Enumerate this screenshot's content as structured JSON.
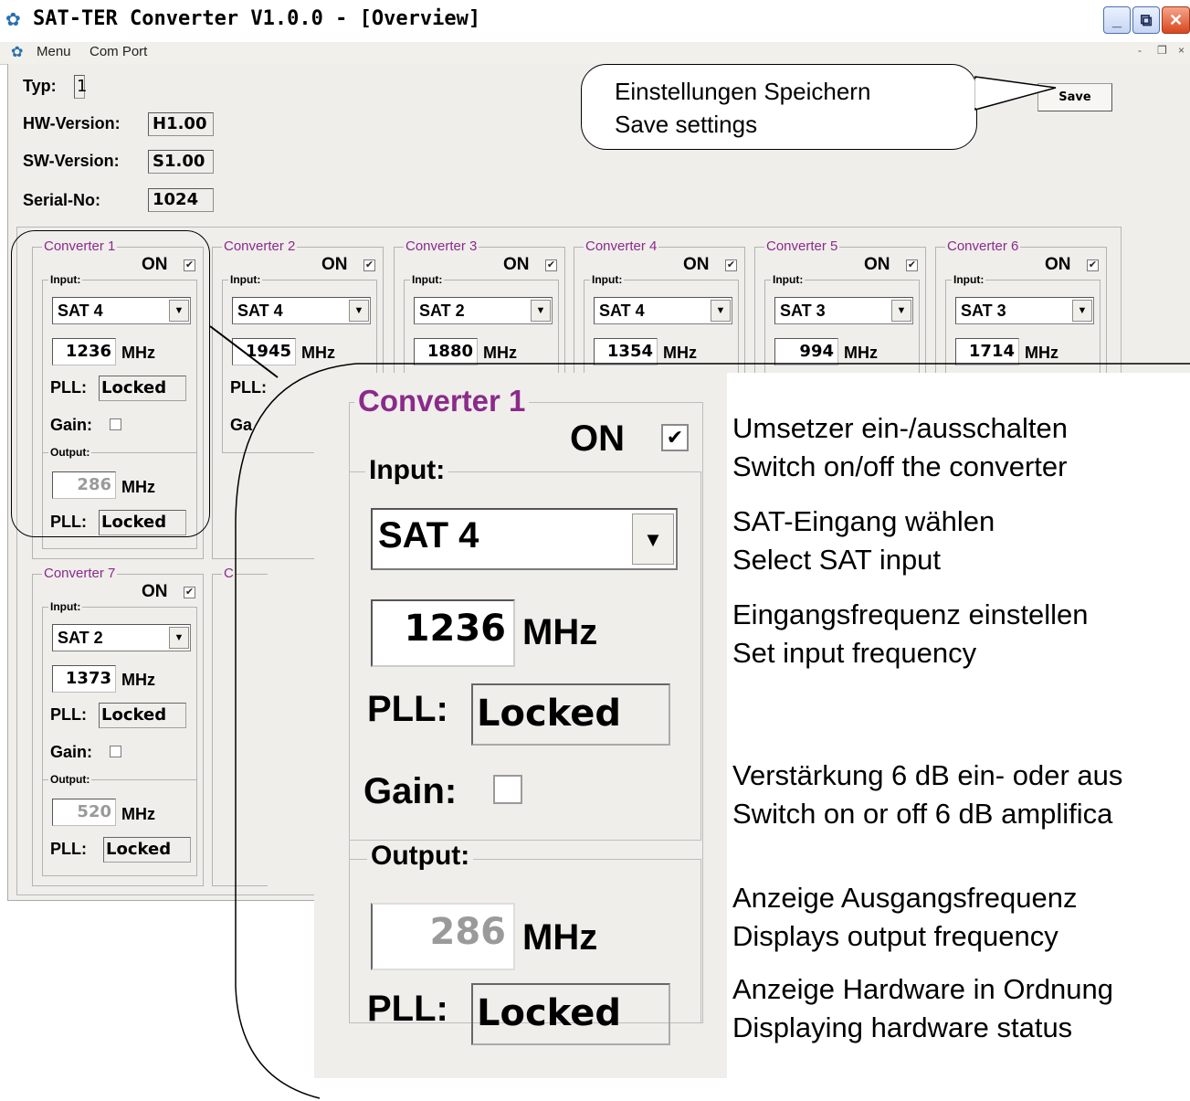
{
  "window": {
    "title": "SAT-TER Converter V1.0.0 - [Overview]",
    "minimize": "_",
    "restore": "⧉",
    "close": "✕"
  },
  "menu": {
    "items": [
      "Menu",
      "Com Port"
    ],
    "mdi_minimize": "-",
    "mdi_restore": "❐",
    "mdi_close": "×"
  },
  "device": {
    "typ_label": "Typ:",
    "typ_value": "1",
    "hw_label": "HW-Version:",
    "hw_value": "H1.00",
    "sw_label": "SW-Version:",
    "sw_value": "S1.00",
    "serial_label": "Serial-No:",
    "serial_value": "1024"
  },
  "save_button": "Save",
  "save_callout": {
    "line1": "Einstellungen Speichern",
    "line2": "Save settings"
  },
  "labels": {
    "on": "ON",
    "input": "Input:",
    "output": "Output:",
    "mhz": "MHz",
    "pll": "PLL:",
    "gain": "Gain:",
    "check": "✔"
  },
  "converters": [
    {
      "title": "Converter 1",
      "input": "SAT 4",
      "in_freq": "1236",
      "pll_in": "Locked",
      "out_freq": "286",
      "pll_out": "Locked",
      "on": true,
      "gain": false
    },
    {
      "title": "Converter 2",
      "input": "SAT 4",
      "in_freq": "1945",
      "on": true
    },
    {
      "title": "Converter 3",
      "input": "SAT 2",
      "in_freq": "1880",
      "on": true
    },
    {
      "title": "Converter 4",
      "input": "SAT 4",
      "in_freq": "1354",
      "on": true
    },
    {
      "title": "Converter 5",
      "input": "SAT 3",
      "in_freq": "994",
      "on": true
    },
    {
      "title": "Converter 6",
      "input": "SAT 3",
      "in_freq": "1714",
      "on": true
    },
    {
      "title": "Converter 7",
      "input": "SAT 2",
      "in_freq": "1373",
      "pll_in": "Locked",
      "out_freq": "520",
      "pll_out": "Locked",
      "on": true,
      "gain": false
    }
  ],
  "partial_labels": {
    "pll_c2": "PLL:",
    "gain_c2": "Ga",
    "c8": "C"
  },
  "zoom": {
    "title": "Converter 1",
    "on": "ON",
    "input_label": "Input:",
    "input": "SAT 4",
    "in_freq": "1236",
    "mhz": "MHz",
    "pll": "PLL:",
    "pll_in": "Locked",
    "gain": "Gain:",
    "output_label": "Output:",
    "out_freq": "286",
    "pll_out": "Locked"
  },
  "annotations": [
    "Umsetzer ein-/ausschalten",
    "Switch on/off the converter",
    "SAT-Eingang wählen",
    "Select SAT input",
    "Eingangsfrequenz einstellen",
    "Set input frequency",
    "Verstärkung 6 dB ein- oder aus",
    "Switch on or off 6 dB amplifica",
    "Anzeige Ausgangsfrequenz",
    "Displays output frequency",
    "Anzeige Hardware in Ordnung",
    "Displaying hardware status"
  ]
}
